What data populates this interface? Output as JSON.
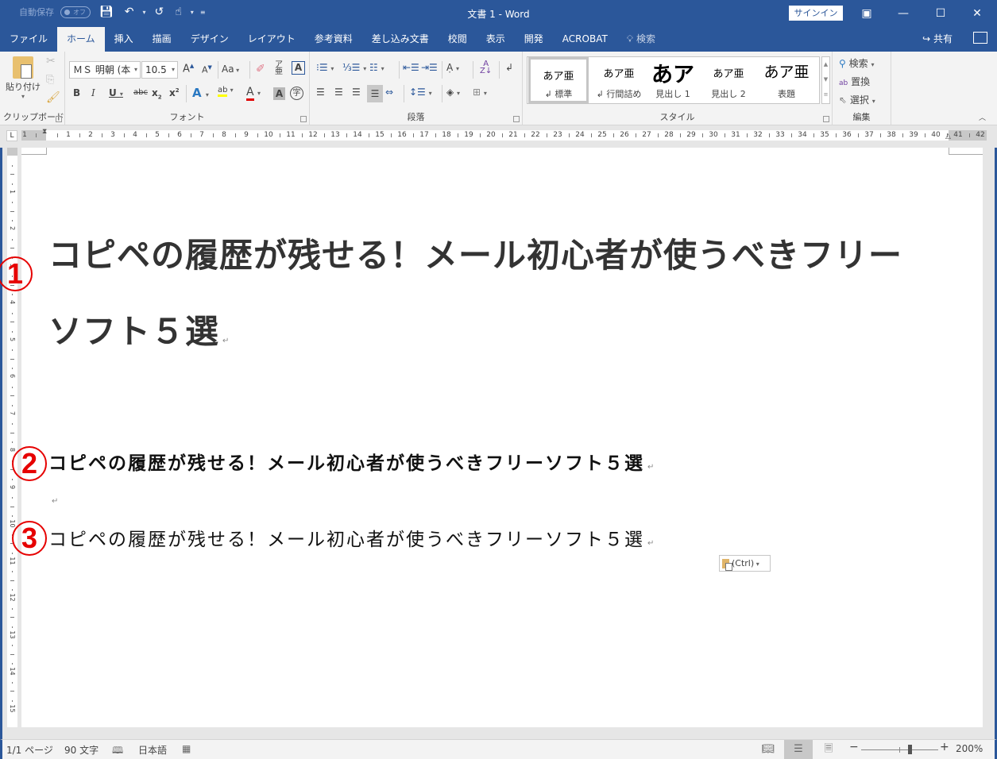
{
  "titlebar": {
    "autosave_label": "自動保存",
    "autosave_state": "オフ",
    "window_title": "文書 1  -  Word",
    "signin_label": "サインイン",
    "qat_icons": [
      "save-icon",
      "undo-icon",
      "redo-icon",
      "touch-mode-icon",
      "customize-qat-icon"
    ],
    "controls": {
      "ribbon_display": "▣",
      "minimize": "—",
      "maximize": "☐",
      "close": "✕"
    }
  },
  "tabs": [
    {
      "label": "ファイル",
      "active": false
    },
    {
      "label": "ホーム",
      "active": true
    },
    {
      "label": "挿入",
      "active": false
    },
    {
      "label": "描画",
      "active": false
    },
    {
      "label": "デザイン",
      "active": false
    },
    {
      "label": "レイアウト",
      "active": false
    },
    {
      "label": "参考資料",
      "active": false
    },
    {
      "label": "差し込み文書",
      "active": false
    },
    {
      "label": "校閲",
      "active": false
    },
    {
      "label": "表示",
      "active": false
    },
    {
      "label": "開発",
      "active": false
    },
    {
      "label": "ACROBAT",
      "active": false
    }
  ],
  "tell_me": {
    "label": "検索"
  },
  "share": {
    "label": "共有"
  },
  "ribbon": {
    "clipboard": {
      "label": "クリップボード",
      "paste_label": "貼り付け"
    },
    "font": {
      "label": "フォント",
      "font_name": "ＭＳ 明朝 (本",
      "font_size": "10.5",
      "case_label": "Aa"
    },
    "paragraph": {
      "label": "段落"
    },
    "styles": {
      "label": "スタイル",
      "items": [
        {
          "preview": "あア亜",
          "name": "↲ 標準",
          "active": true
        },
        {
          "preview": "あア亜",
          "name": "↲ 行間詰め",
          "active": false
        },
        {
          "preview": "あア",
          "name": "見出し 1",
          "active": false
        },
        {
          "preview": "あア亜",
          "name": "見出し 2",
          "active": false
        },
        {
          "preview": "あア亜",
          "name": "表題",
          "active": false
        }
      ]
    },
    "editing": {
      "label": "編集",
      "find": "検索",
      "replace": "置換",
      "select": "選択"
    }
  },
  "ruler": {
    "left_margin_numbers": [
      "1"
    ],
    "numbers": [
      "1",
      "2",
      "3",
      "4",
      "5",
      "6",
      "7",
      "8",
      "9",
      "10",
      "11",
      "12",
      "13",
      "14",
      "15",
      "16",
      "17",
      "18",
      "19",
      "20",
      "21",
      "22",
      "23",
      "24",
      "25",
      "26",
      "27",
      "28",
      "29",
      "30",
      "31",
      "32",
      "33",
      "34",
      "35",
      "36",
      "37",
      "38",
      "39",
      "40"
    ],
    "right_margin_numbers": [
      "41",
      "42"
    ],
    "vertical_numbers": [
      "1",
      "2",
      "3",
      "4",
      "5",
      "6",
      "7",
      "8",
      "9",
      "10",
      "11",
      "12",
      "13",
      "14",
      "15"
    ]
  },
  "document": {
    "heading_line1": "コピペの履歴が残せる！メール初心者が使うべきフリー",
    "heading_line2": "ソフト５選",
    "paragraph2": "コピペの履歴が残せる！メール初心者が使うべきフリーソフト５選",
    "paragraph3": "コピペの履歴が残せる！メール初心者が使うべきフリーソフト５選",
    "paragraph_mark": "↵",
    "annotations": [
      "①",
      "②",
      "③"
    ],
    "paste_options_label": "(Ctrl)"
  },
  "statusbar": {
    "page": "1/1 ページ",
    "words": "90 文字",
    "language": "日本語",
    "zoom_percent": "200%",
    "zoom_value": 200
  },
  "colors": {
    "brand": "#2b579a",
    "annotation_red": "#e60000",
    "ribbon_bg": "#f3f3f3"
  }
}
